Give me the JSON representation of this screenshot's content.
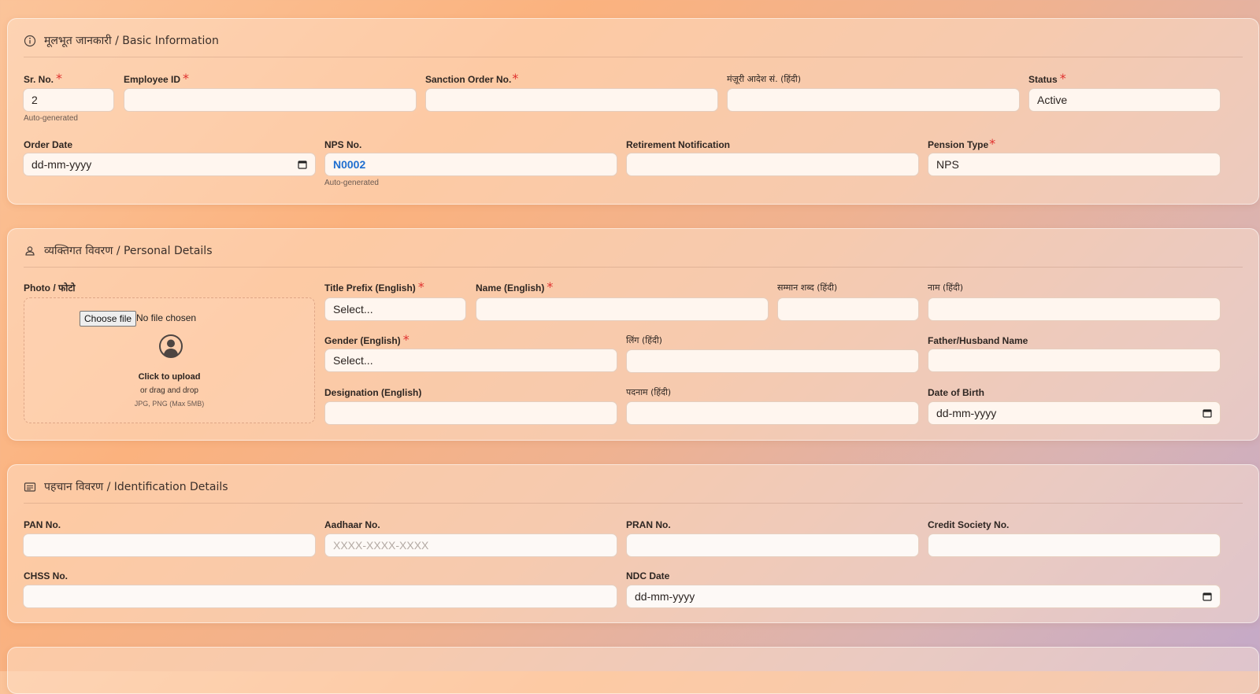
{
  "basic": {
    "title": "मूलभूत जानकारी / Basic Information",
    "sr_no": {
      "label": "Sr. No.",
      "value": "2",
      "hint": "Auto-generated"
    },
    "employee_id": {
      "label": "Employee ID",
      "value": ""
    },
    "sanction_order": {
      "label": "Sanction Order No.",
      "value": ""
    },
    "sanction_order_hi": {
      "label": "मंज़ूरी आदेश सं. (हिंदी)",
      "value": ""
    },
    "status": {
      "label": "Status",
      "value": "Active"
    },
    "order_date": {
      "label": "Order Date",
      "value": "dd-mm-yyyy"
    },
    "nps_no": {
      "label": "NPS No.",
      "value": "N0002",
      "hint": "Auto-generated"
    },
    "retirement": {
      "label": "Retirement Notification",
      "value": ""
    },
    "pension_type": {
      "label": "Pension Type",
      "value": "NPS"
    }
  },
  "personal": {
    "title": "व्यक्तिगत विवरण / Personal Details",
    "photo": {
      "label": "Photo / फोटो",
      "choose_label": "Choose file",
      "file_status": "No file chosen",
      "upload_text": "Click to upload",
      "upload_sub": "or drag and drop",
      "upload_formats": "JPG, PNG (Max 5MB)"
    },
    "title_prefix": {
      "label": "Title Prefix (English)",
      "value": "Select..."
    },
    "name_en": {
      "label": "Name (English)",
      "value": ""
    },
    "honorific_hi": {
      "label": "सम्मान शब्द (हिंदी)",
      "value": ""
    },
    "name_hi": {
      "label": "नाम (हिंदी)",
      "value": ""
    },
    "gender": {
      "label": "Gender (English)",
      "value": "Select..."
    },
    "gender_hi": {
      "label": "लिंग (हिंदी)",
      "value": ""
    },
    "father_name": {
      "label": "Father/Husband Name",
      "value": ""
    },
    "designation": {
      "label": "Designation (English)",
      "value": ""
    },
    "designation_hi": {
      "label": "पदनाम (हिंदी)",
      "value": ""
    },
    "dob": {
      "label": "Date of Birth",
      "value": "dd-mm-yyyy"
    }
  },
  "identification": {
    "title": "पहचान विवरण / Identification Details",
    "pan": {
      "label": "PAN No.",
      "value": ""
    },
    "aadhaar": {
      "label": "Aadhaar No.",
      "placeholder": "XXXX-XXXX-XXXX"
    },
    "pran": {
      "label": "PRAN No.",
      "value": ""
    },
    "credit_society": {
      "label": "Credit Society No.",
      "value": ""
    },
    "chss": {
      "label": "CHSS No.",
      "value": ""
    },
    "ndc_date": {
      "label": "NDC Date",
      "value": "dd-mm-yyyy"
    }
  },
  "icons": {
    "basic": "info-icon",
    "personal": "user-icon",
    "identification": "id-card-icon",
    "date": "calendar-icon",
    "photo": "user-circle-icon"
  },
  "colors": {
    "required": "#e0312f",
    "nps_value": "#1f6fd0",
    "input_bg": "#fff6ef"
  }
}
